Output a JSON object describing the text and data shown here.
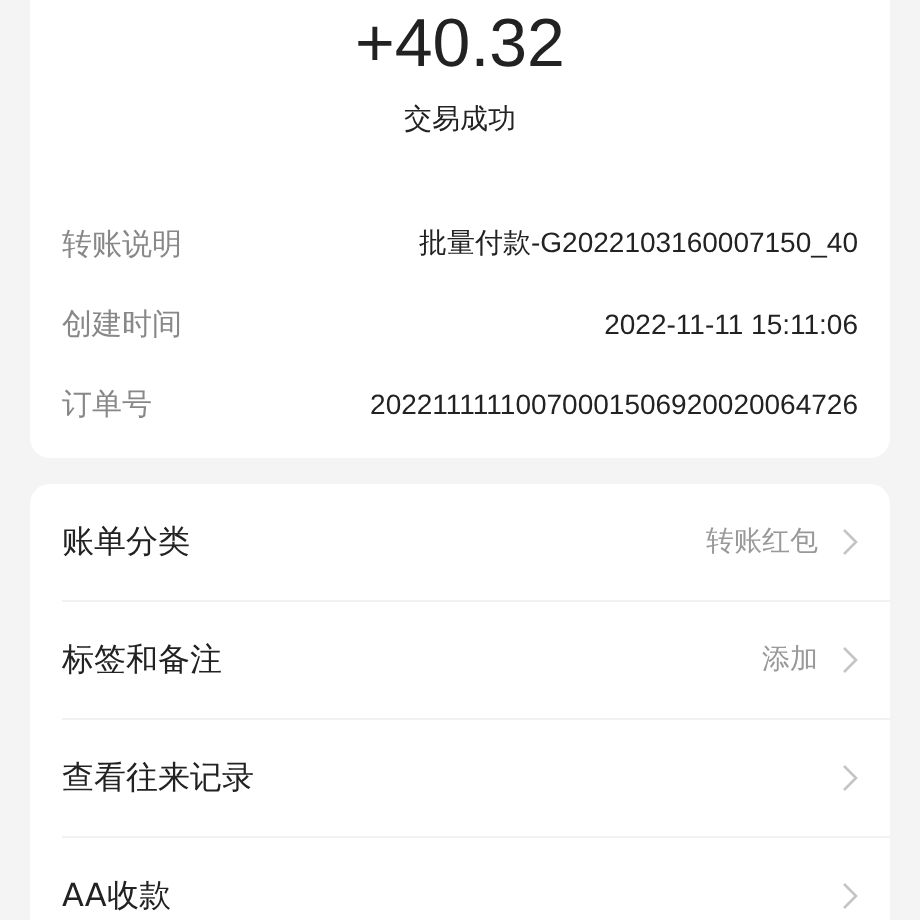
{
  "amount": "+40.32",
  "status": "交易成功",
  "details": [
    {
      "label": "转账说明",
      "value": "批量付款-G2022103160007150_40"
    },
    {
      "label": "创建时间",
      "value": "2022-11-11 15:11:06"
    },
    {
      "label": "订单号",
      "value": "20221111110070001506920020064726"
    }
  ],
  "menu": [
    {
      "label": "账单分类",
      "value": "转账红包"
    },
    {
      "label": "标签和备注",
      "value": "添加"
    },
    {
      "label": "查看往来记录"
    },
    {
      "label": "AA收款"
    }
  ]
}
